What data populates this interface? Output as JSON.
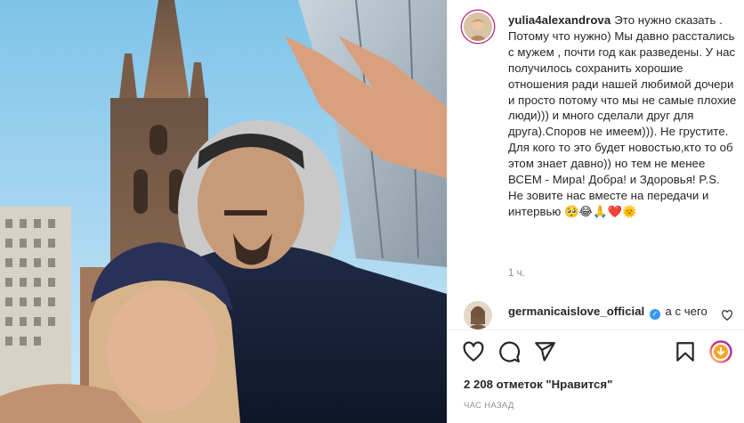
{
  "post": {
    "author": "yulia4alexandrova",
    "caption": "Это нужно сказать . Потому что нужно) Мы давно расстались с мужем , почти год как разведены. У нас получилось сохранить хорошие отношения ради нашей любимой дочери и просто потому что мы не самые плохие люди))) и много сделали друг для друга).Споров не имеем))). Не грустите. Для кого то это будет новостью,кто то об этом знает давно)) но тем не менее ВСЕМ - Мира! Добра! и Здоровья! P.S. Не зовите нас вместе на передачи и интервью 🥺😂🙏❤️🌞",
    "time_ago": "1 ч.",
    "likes": "2 208 отметок \"Нравится\"",
    "posted": "ЧАС НАЗАД"
  },
  "comment": {
    "author": "germanicaislove_official",
    "verified_badge": "✓",
    "text": "а с чего"
  },
  "icons": {
    "like": "heart-outline-icon",
    "comment": "speech-bubble-icon",
    "share": "paper-plane-icon",
    "save": "bookmark-icon",
    "overlay": "circular-download-icon",
    "comment_like": "heart-small-icon"
  },
  "colors": {
    "text": "#262626",
    "muted": "#8e8e8e",
    "verified": "#3897f0",
    "overlay_ring": "#e1306c"
  }
}
